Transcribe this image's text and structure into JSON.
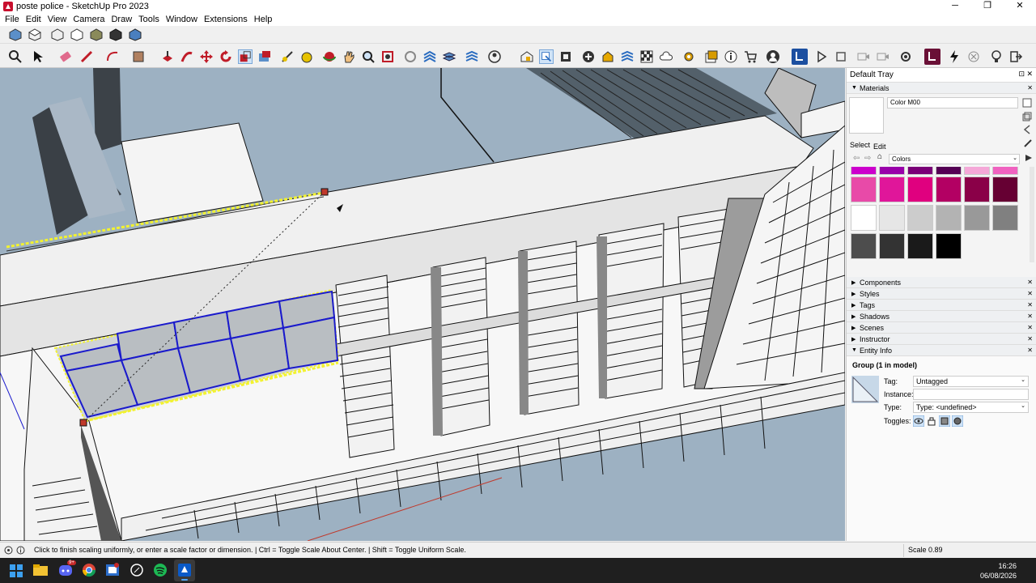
{
  "window": {
    "title": "poste police - SketchUp Pro 2023",
    "minimize": "─",
    "maximize": "❐",
    "close": "✕"
  },
  "menu": [
    "File",
    "Edit",
    "View",
    "Camera",
    "Draw",
    "Tools",
    "Window",
    "Extensions",
    "Help"
  ],
  "tray": {
    "title": "Default Tray",
    "materials": {
      "header": "Materials",
      "material_name": "Color M00",
      "tab_select": "Select",
      "tab_edit": "Edit",
      "library": "Colors",
      "swatch_colors": [
        [
          "#cc00cc",
          "#9900aa",
          "#7a0077",
          "#550055",
          "#f5a8d8",
          "#f062c0"
        ],
        [
          "#e84aa8",
          "#e0169a",
          "#e0007f",
          "#b30063",
          "#8a0048",
          "#660033"
        ],
        [
          "#ffffff",
          "#e6e6e6",
          "#cccccc",
          "#b3b3b3",
          "#999999",
          "#808080"
        ],
        [
          "#4d4d4d",
          "#333333",
          "#1a1a1a",
          "#000000"
        ]
      ]
    },
    "panels": [
      "Components",
      "Styles",
      "Tags",
      "Shadows",
      "Scenes",
      "Instructor"
    ],
    "entity_info": {
      "header": "Entity Info",
      "selection": "Group (1 in model)",
      "tag_label": "Tag:",
      "tag_value": "Untagged",
      "instance_label": "Instance:",
      "instance_value": "",
      "type_label": "Type:",
      "type_value": "Type: <undefined>",
      "toggles_label": "Toggles:"
    }
  },
  "status": {
    "message": "Click to finish scaling uniformly, or enter a scale factor or dimension. | Ctrl = Toggle Scale About Center. | Shift = Toggle Uniform Scale.",
    "measure_label": "Scale",
    "measure_value": "0.89"
  },
  "taskbar": {
    "time": "16:26",
    "date": "06/08/2026",
    "discord_badge": "9+"
  },
  "colors": {
    "sky": "#9db1c2",
    "selection_yellow": "#f2f230",
    "selection_blue": "#1a1acc",
    "accent": "#0a5ac8"
  }
}
